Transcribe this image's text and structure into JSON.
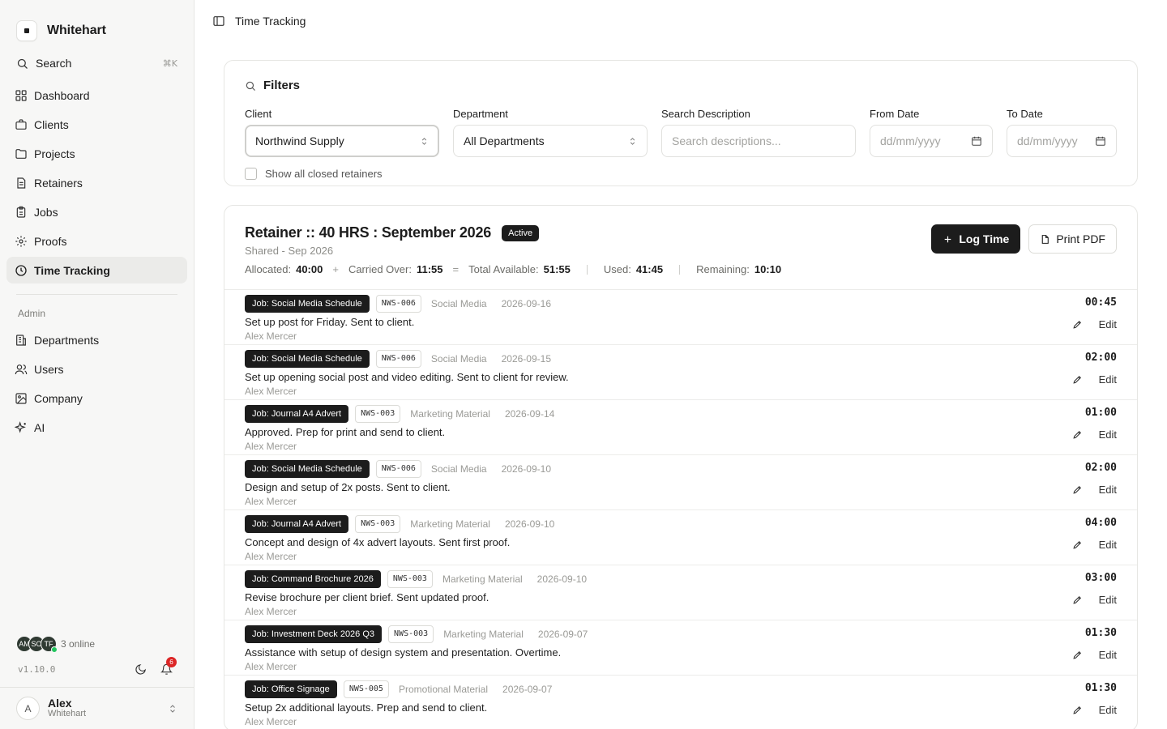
{
  "brand": {
    "name": "Whitehart"
  },
  "search": {
    "label": "Search",
    "shortcut": "⌘K"
  },
  "nav": {
    "items": [
      {
        "label": "Dashboard"
      },
      {
        "label": "Clients"
      },
      {
        "label": "Projects"
      },
      {
        "label": "Retainers"
      },
      {
        "label": "Jobs"
      },
      {
        "label": "Proofs"
      },
      {
        "label": "Time Tracking"
      }
    ],
    "admin_label": "Admin",
    "admin_items": [
      {
        "label": "Departments"
      },
      {
        "label": "Users"
      },
      {
        "label": "Company"
      },
      {
        "label": "AI"
      }
    ]
  },
  "presence": {
    "avatars": [
      "AM",
      "SO",
      "TF"
    ],
    "online_text": "3 online"
  },
  "footer": {
    "version": "v1.10.0",
    "notification_count": "6"
  },
  "user": {
    "initial": "A",
    "name": "Alex",
    "company": "Whitehart"
  },
  "topbar": {
    "title": "Time Tracking"
  },
  "filters": {
    "title": "Filters",
    "client_label": "Client",
    "client_value": "Northwind Supply",
    "department_label": "Department",
    "department_value": "All Departments",
    "search_label": "Search Description",
    "search_placeholder": "Search descriptions...",
    "from_label": "From Date",
    "from_placeholder": "dd/mm/yyyy",
    "to_label": "To Date",
    "to_placeholder": "dd/mm/yyyy",
    "closed_label": "Show all closed retainers"
  },
  "retainer": {
    "title": "Retainer :: 40 HRS : September 2026",
    "status": "Active",
    "subtitle": "Shared - Sep 2026",
    "allocated_label": "Allocated:",
    "allocated": "40:00",
    "plus": "+",
    "carried_label": "Carried Over:",
    "carried": "11:55",
    "equals": "=",
    "total_label": "Total Available:",
    "total": "51:55",
    "used_label": "Used:",
    "used": "41:45",
    "remaining_label": "Remaining:",
    "remaining": "10:10",
    "log_time": "Log Time",
    "print_pdf": "Print PDF"
  },
  "entries": [
    {
      "job": "Job: Social Media Schedule",
      "code": "NWS-006",
      "dept": "Social Media",
      "date": "2026-09-16",
      "desc": "Set up post for Friday. Sent to client.",
      "who": "Alex Mercer",
      "hours": "00:45",
      "edit": "Edit"
    },
    {
      "job": "Job: Social Media Schedule",
      "code": "NWS-006",
      "dept": "Social Media",
      "date": "2026-09-15",
      "desc": "Set up opening social post and video editing. Sent to client for review.",
      "who": "Alex Mercer",
      "hours": "02:00",
      "edit": "Edit"
    },
    {
      "job": "Job: Journal A4 Advert",
      "code": "NWS-003",
      "dept": "Marketing Material",
      "date": "2026-09-14",
      "desc": "Approved. Prep for print and send to client.",
      "who": "Alex Mercer",
      "hours": "01:00",
      "edit": "Edit"
    },
    {
      "job": "Job: Social Media Schedule",
      "code": "NWS-006",
      "dept": "Social Media",
      "date": "2026-09-10",
      "desc": "Design and setup of 2x posts. Sent to client.",
      "who": "Alex Mercer",
      "hours": "02:00",
      "edit": "Edit"
    },
    {
      "job": "Job: Journal A4 Advert",
      "code": "NWS-003",
      "dept": "Marketing Material",
      "date": "2026-09-10",
      "desc": "Concept and design of 4x advert layouts. Sent first proof.",
      "who": "Alex Mercer",
      "hours": "04:00",
      "edit": "Edit"
    },
    {
      "job": "Job: Command Brochure 2026",
      "code": "NWS-003",
      "dept": "Marketing Material",
      "date": "2026-09-10",
      "desc": "Revise brochure per client brief. Sent updated proof.",
      "who": "Alex Mercer",
      "hours": "03:00",
      "edit": "Edit"
    },
    {
      "job": "Job: Investment Deck 2026 Q3",
      "code": "NWS-003",
      "dept": "Marketing Material",
      "date": "2026-09-07",
      "desc": "Assistance with setup of design system and presentation. Overtime.",
      "who": "Alex Mercer",
      "hours": "01:30",
      "edit": "Edit"
    },
    {
      "job": "Job: Office Signage",
      "code": "NWS-005",
      "dept": "Promotional Material",
      "date": "2026-09-07",
      "desc": "Setup 2x additional layouts. Prep and send to client.",
      "who": "Alex Mercer",
      "hours": "01:30",
      "edit": "Edit"
    }
  ]
}
